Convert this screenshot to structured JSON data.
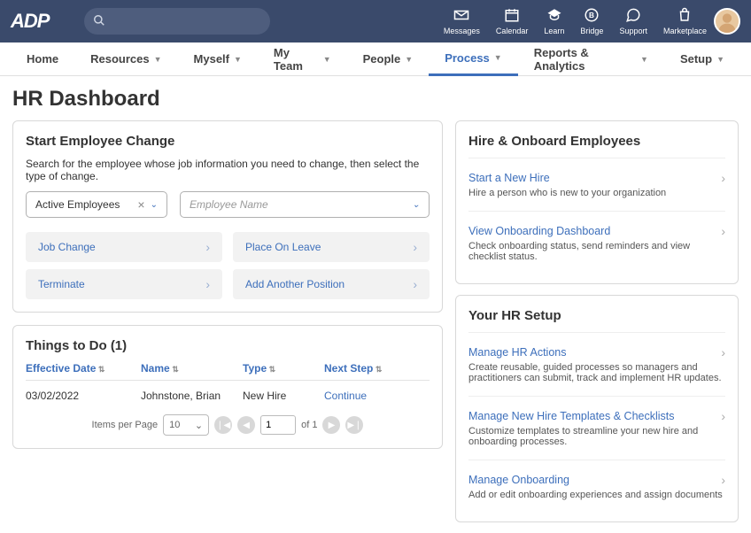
{
  "topnav": {
    "logo": "ADP",
    "icons": [
      {
        "label": "Messages",
        "icon": "envelope"
      },
      {
        "label": "Calendar",
        "icon": "calendar"
      },
      {
        "label": "Learn",
        "icon": "graduation"
      },
      {
        "label": "Bridge",
        "icon": "circled-b"
      },
      {
        "label": "Support",
        "icon": "chat"
      },
      {
        "label": "Marketplace",
        "icon": "shopping"
      }
    ]
  },
  "menu": [
    {
      "label": "Home",
      "caret": false
    },
    {
      "label": "Resources",
      "caret": true
    },
    {
      "label": "Myself",
      "caret": true
    },
    {
      "label": "My Team",
      "caret": true
    },
    {
      "label": "People",
      "caret": true
    },
    {
      "label": "Process",
      "caret": true,
      "active": true
    },
    {
      "label": "Reports & Analytics",
      "caret": true
    },
    {
      "label": "Setup",
      "caret": true
    }
  ],
  "page_title": "HR Dashboard",
  "start_change": {
    "title": "Start Employee Change",
    "instruction": "Search for the employee whose job information you need to change, then select the type of change.",
    "filter_selected": "Active Employees",
    "name_placeholder": "Employee Name",
    "actions": [
      {
        "label": "Job Change"
      },
      {
        "label": "Place On Leave"
      },
      {
        "label": "Terminate"
      },
      {
        "label": "Add Another Position"
      }
    ]
  },
  "things": {
    "title": "Things to Do (1)",
    "columns": {
      "date": "Effective Date",
      "name": "Name",
      "type": "Type",
      "next": "Next Step"
    },
    "rows": [
      {
        "date": "03/02/2022",
        "name": "Johnstone, Brian",
        "type": "New Hire",
        "next": "Continue"
      }
    ],
    "pager": {
      "items_label": "Items per Page",
      "per_page": "10",
      "page": "1",
      "of_label": "of 1"
    }
  },
  "hire": {
    "title": "Hire & Onboard Employees",
    "items": [
      {
        "title": "Start a New Hire",
        "desc": "Hire a person who is new to your organization"
      },
      {
        "title": "View Onboarding Dashboard",
        "desc": "Check onboarding status, send reminders and view checklist status."
      }
    ]
  },
  "setup": {
    "title": "Your HR Setup",
    "items": [
      {
        "title": "Manage HR Actions",
        "desc": "Create reusable, guided processes so managers and practitioners can submit, track and implement HR updates."
      },
      {
        "title": "Manage New Hire Templates & Checklists",
        "desc": "Customize templates to streamline your new hire and onboarding processes."
      },
      {
        "title": "Manage Onboarding",
        "desc": "Add or edit onboarding experiences and assign documents"
      }
    ]
  }
}
